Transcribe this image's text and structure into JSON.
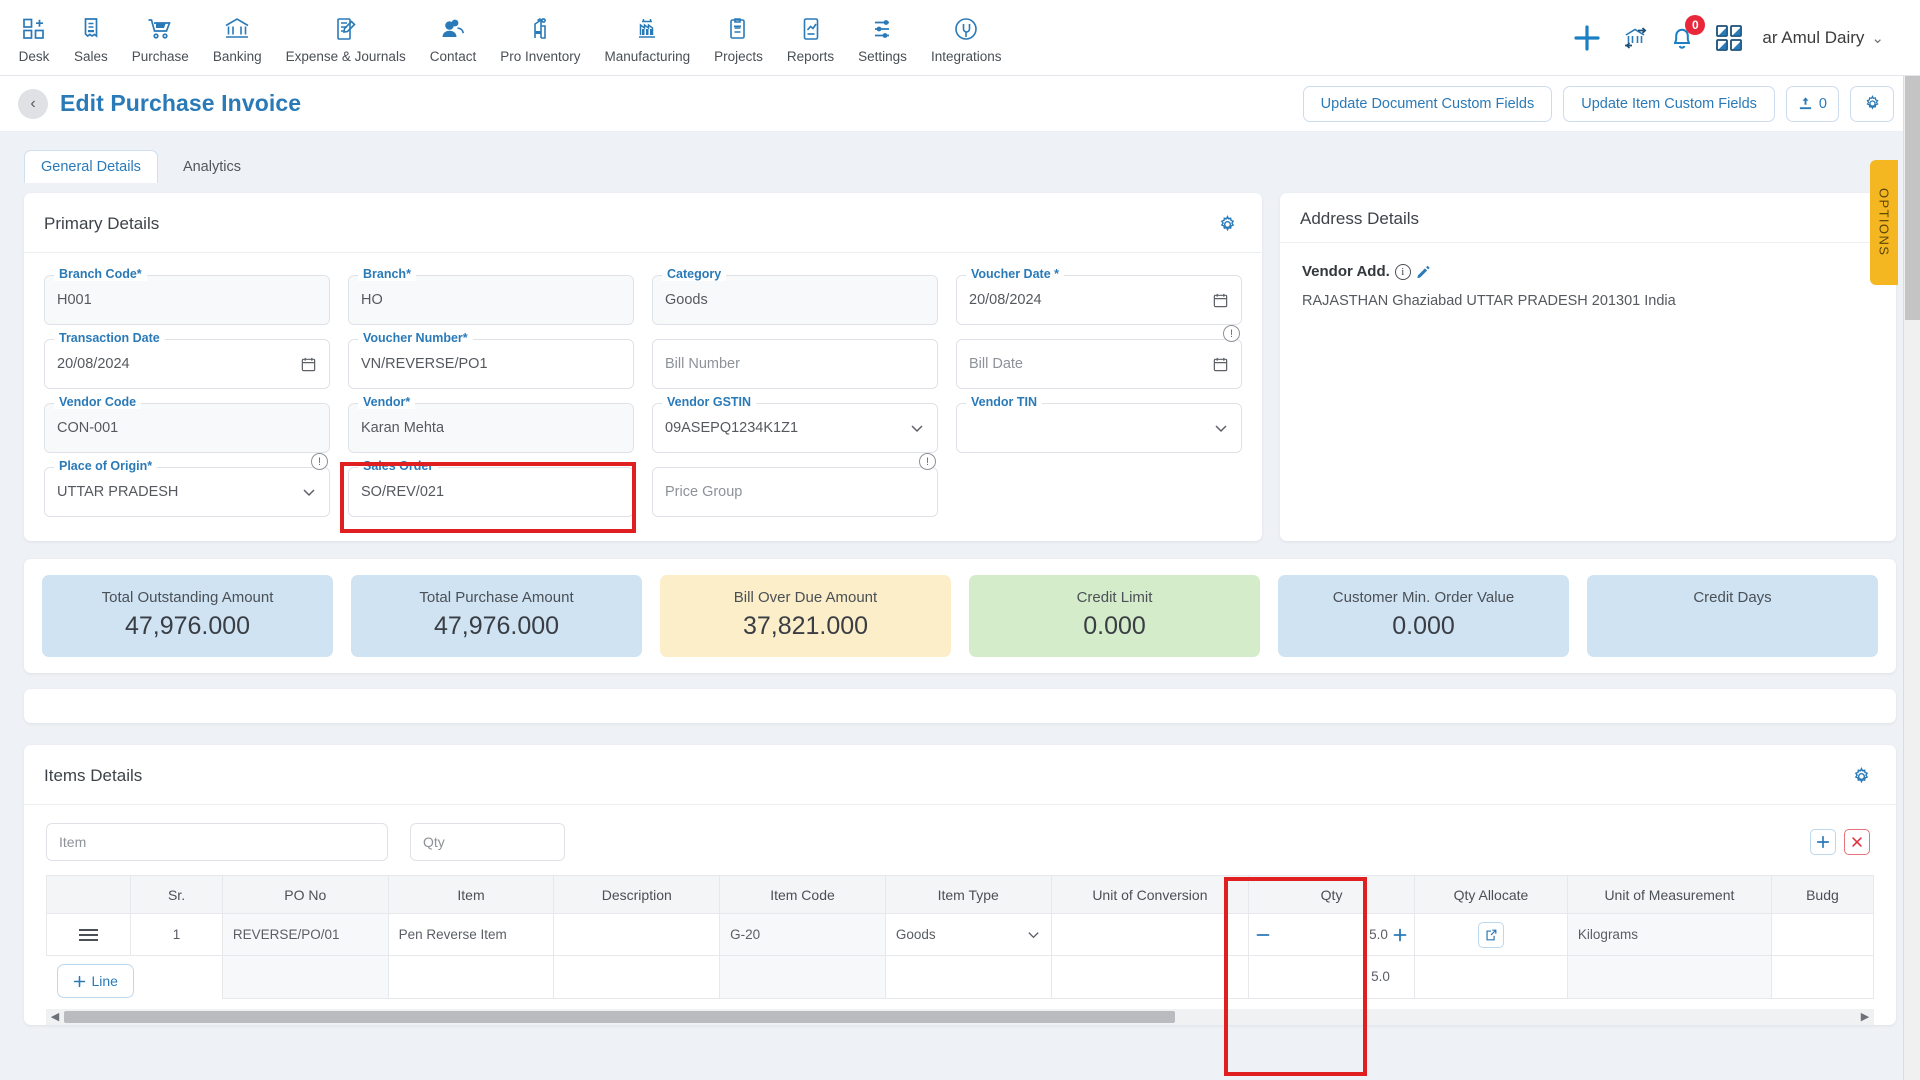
{
  "nav": {
    "items": [
      {
        "label": "Desk",
        "icon": "desk-icon"
      },
      {
        "label": "Sales",
        "icon": "sales-icon"
      },
      {
        "label": "Purchase",
        "icon": "purchase-cart-icon"
      },
      {
        "label": "Banking",
        "icon": "bank-icon"
      },
      {
        "label": "Expense & Journals",
        "icon": "journal-icon"
      },
      {
        "label": "Contact",
        "icon": "contact-icon"
      },
      {
        "label": "Pro Inventory",
        "icon": "inventory-icon"
      },
      {
        "label": "Manufacturing",
        "icon": "manufacturing-icon"
      },
      {
        "label": "Projects",
        "icon": "projects-icon"
      },
      {
        "label": "Reports",
        "icon": "reports-icon"
      },
      {
        "label": "Settings",
        "icon": "settings-sliders-icon"
      },
      {
        "label": "Integrations",
        "icon": "integrations-plug-icon"
      }
    ],
    "add_icon": "plus-icon",
    "branch_icon": "branch-transfer-icon",
    "notification_icon": "bell-icon",
    "notification_count": "0",
    "apps_icon": "grid-apps-icon",
    "company": "ar Amul Dairy",
    "company_caret": "chevron-down-icon"
  },
  "header": {
    "back_icon": "chevron-left-icon",
    "title": "Edit Purchase Invoice",
    "btn_update_document": "Update Document Custom Fields",
    "btn_update_item": "Update Item Custom Fields",
    "attachment_count": "0",
    "attachment_icon": "upload-icon",
    "gear_icon": "gear-icon"
  },
  "tabs": [
    {
      "label": "General Details",
      "active": true
    },
    {
      "label": "Analytics",
      "active": false
    }
  ],
  "primary_details": {
    "title": "Primary Details",
    "gear_icon": "gear-icon",
    "fields": [
      {
        "label": "Branch Code",
        "required": true,
        "value": "H001",
        "placeholder": "",
        "type": "text",
        "filled": true
      },
      {
        "label": "Branch",
        "required": true,
        "value": "HO",
        "placeholder": "",
        "type": "text",
        "filled": true
      },
      {
        "label": "Category",
        "required": false,
        "value": "Goods",
        "placeholder": "",
        "type": "text",
        "filled": true
      },
      {
        "label": "Voucher Date *",
        "required": false,
        "value": "20/08/2024",
        "placeholder": "",
        "type": "date",
        "filled": false
      },
      {
        "label": "Transaction Date",
        "required": false,
        "value": "20/08/2024",
        "placeholder": "",
        "type": "date",
        "filled": false
      },
      {
        "label": "Voucher Number",
        "required": true,
        "value": "VN/REVERSE/PO1",
        "placeholder": "",
        "type": "text",
        "filled": false
      },
      {
        "label": "",
        "required": false,
        "value": "",
        "placeholder": "Bill Number",
        "type": "text",
        "filled": false
      },
      {
        "label": "",
        "required": false,
        "value": "",
        "placeholder": "Bill Date",
        "type": "date",
        "filled": false,
        "info": true
      },
      {
        "label": "Vendor Code",
        "required": false,
        "value": "CON-001",
        "placeholder": "",
        "type": "text",
        "filled": true
      },
      {
        "label": "Vendor",
        "required": true,
        "value": "Karan Mehta",
        "placeholder": "",
        "type": "text",
        "filled": true
      },
      {
        "label": "Vendor GSTIN",
        "required": false,
        "value": "09ASEPQ1234K1Z1",
        "placeholder": "",
        "type": "select",
        "filled": false
      },
      {
        "label": "Vendor TIN",
        "required": false,
        "value": "",
        "placeholder": "",
        "type": "select",
        "filled": false
      },
      {
        "label": "Place of Origin",
        "required": true,
        "value": "UTTAR PRADESH",
        "placeholder": "",
        "type": "select",
        "filled": false,
        "info": true
      },
      {
        "label": "Sales Order",
        "required": false,
        "value": "SO/REV/021",
        "placeholder": "",
        "type": "text",
        "filled": false,
        "highlighted": true
      },
      {
        "label": "",
        "required": false,
        "value": "",
        "placeholder": "Price Group",
        "type": "text",
        "filled": false,
        "info": true
      }
    ]
  },
  "address_details": {
    "title": "Address Details",
    "vendor_label": "Vendor Add.",
    "info_icon": "info-circle-icon",
    "edit_icon": "pencil-icon",
    "address": "RAJASTHAN Ghaziabad UTTAR PRADESH 201301 India"
  },
  "stats": [
    {
      "title": "Total Outstanding Amount",
      "value": "47,976.000",
      "color": "#cfe3f3"
    },
    {
      "title": "Total Purchase Amount",
      "value": "47,976.000",
      "color": "#cfe3f3"
    },
    {
      "title": "Bill Over Due Amount",
      "value": "37,821.000",
      "color": "#fbeec8"
    },
    {
      "title": "Credit Limit",
      "value": "0.000",
      "color": "#d4ecc9"
    },
    {
      "title": "Customer Min. Order Value",
      "value": "0.000",
      "color": "#cfe3f3"
    },
    {
      "title": "Credit Days",
      "value": "",
      "color": "#cfe3f3"
    }
  ],
  "items_details": {
    "title": "Items Details",
    "gear_icon": "gear-icon",
    "filters": [
      {
        "placeholder": "Item"
      },
      {
        "placeholder": "Qty"
      }
    ],
    "columns": [
      "",
      "Sr.",
      "PO No",
      "Item",
      "Description",
      "Item Code",
      "Item Type",
      "Unit of Conversion",
      "Qty",
      "Qty Allocate",
      "Unit of Measurement",
      "Budg"
    ],
    "rows": [
      {
        "drag_icon": "drag-handle-icon",
        "sr": "1",
        "po_no": "REVERSE/PO/01",
        "item": "Pen Reverse Item",
        "description": "",
        "item_code": "G-20",
        "item_type": "Goods",
        "item_type_caret": "chevron-down-icon",
        "unit_of_conversion": "",
        "qty_minus": "minus-icon",
        "qty": "5.0",
        "qty_plus": "plus-icon",
        "qty_allocate_icon": "external-link-icon",
        "unit_of_measurement": "Kilograms",
        "budget": "",
        "add_icon": "plus-icon",
        "delete_icon": "close-x-icon"
      }
    ],
    "footer": {
      "add_line_label": "Line",
      "add_line_icon": "plus-icon",
      "qty_total": "5.0"
    },
    "scroll_left_icon": "triangle-left-icon",
    "scroll_right_icon": "triangle-right-icon"
  },
  "options_tab": {
    "label": "OPTIONS"
  }
}
